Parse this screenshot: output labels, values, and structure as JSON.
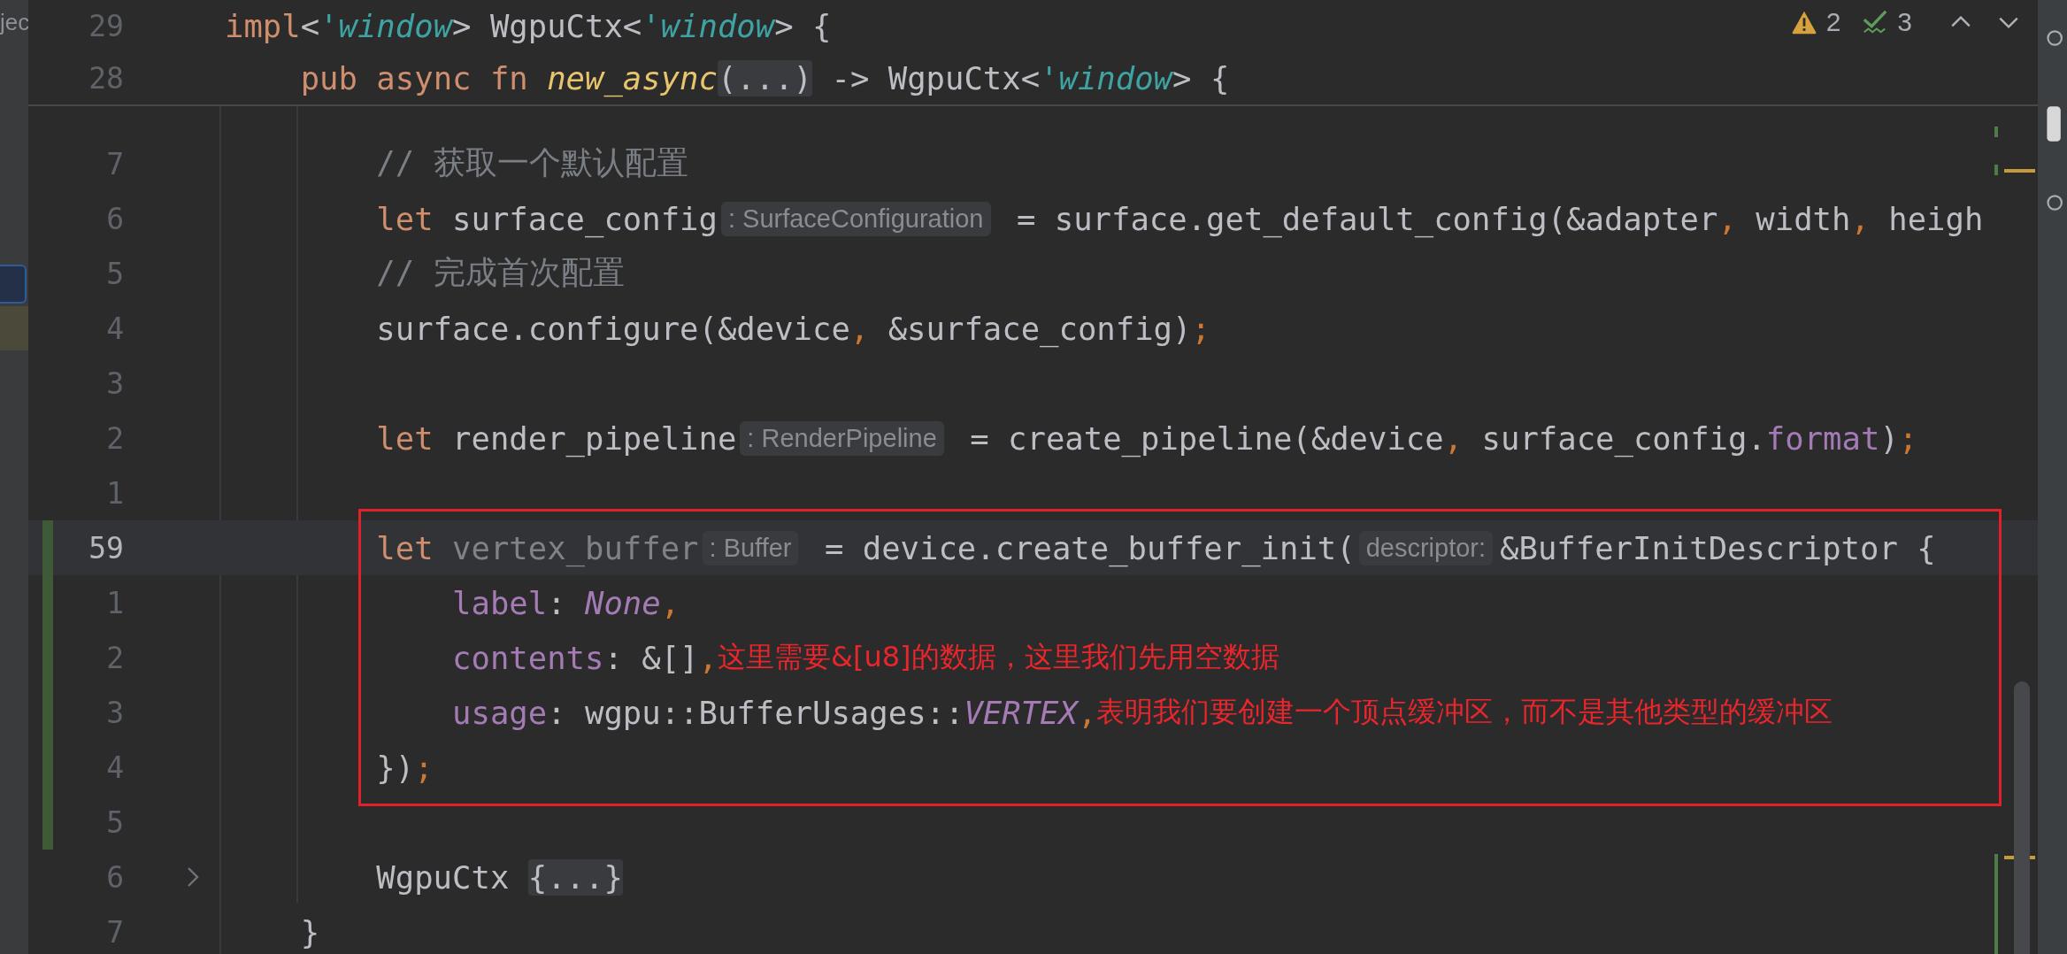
{
  "project_panel": {
    "text": "jec"
  },
  "inspections": [
    {
      "kind": "warning",
      "count": "2"
    },
    {
      "kind": "weak",
      "count": "3"
    }
  ],
  "sticky_lines": [
    {
      "number": "29",
      "segments": [
        {
          "kind": "code",
          "tokens": [
            {
              "kind": "kw",
              "text": "impl"
            },
            {
              "kind": "plain",
              "text": "<"
            },
            {
              "kind": "lifetime",
              "text": "'window"
            },
            {
              "kind": "plain",
              "text": "> WgpuCtx<"
            },
            {
              "kind": "lifetime",
              "text": "'window"
            },
            {
              "kind": "plain",
              "text": "> {"
            }
          ]
        }
      ]
    },
    {
      "number": "28",
      "segments": [
        {
          "kind": "code",
          "tokens": [
            {
              "kind": "kw",
              "text": "    pub async fn "
            },
            {
              "kind": "fn",
              "text": "new_async"
            }
          ]
        },
        {
          "kind": "fold",
          "text": "(...)"
        },
        {
          "kind": "code",
          "tokens": [
            {
              "kind": "plain",
              "text": " -> WgpuCtx<"
            },
            {
              "kind": "lifetime",
              "text": "'window"
            },
            {
              "kind": "plain",
              "text": "> {"
            }
          ]
        }
      ]
    }
  ],
  "lines": [
    {
      "number": "7",
      "current": false,
      "changed": false,
      "foldable": false,
      "segments": [
        {
          "kind": "code",
          "tokens": [
            {
              "kind": "comment",
              "text": "        // 获取一个默认配置"
            }
          ]
        }
      ]
    },
    {
      "number": "6",
      "current": false,
      "changed": false,
      "foldable": false,
      "segments": [
        {
          "kind": "code",
          "tokens": [
            {
              "kind": "kw",
              "text": "        let "
            },
            {
              "kind": "plain",
              "text": "surface_config"
            }
          ]
        },
        {
          "kind": "hint",
          "text": ": SurfaceConfiguration"
        },
        {
          "kind": "code",
          "tokens": [
            {
              "kind": "plain",
              "text": " = surface.get_default_config(&adapter"
            },
            {
              "kind": "punct",
              "text": ","
            },
            {
              "kind": "plain",
              "text": " width"
            },
            {
              "kind": "punct",
              "text": ","
            },
            {
              "kind": "plain",
              "text": " heigh"
            }
          ]
        }
      ]
    },
    {
      "number": "5",
      "current": false,
      "changed": false,
      "foldable": false,
      "segments": [
        {
          "kind": "code",
          "tokens": [
            {
              "kind": "comment",
              "text": "        // 完成首次配置"
            }
          ]
        }
      ]
    },
    {
      "number": "4",
      "current": false,
      "changed": false,
      "foldable": false,
      "segments": [
        {
          "kind": "code",
          "tokens": [
            {
              "kind": "plain",
              "text": "        surface.configure(&device"
            },
            {
              "kind": "punct",
              "text": ","
            },
            {
              "kind": "plain",
              "text": " &surface_config)"
            },
            {
              "kind": "punct",
              "text": ";"
            }
          ]
        }
      ]
    },
    {
      "number": "3",
      "current": false,
      "changed": false,
      "foldable": false
    },
    {
      "number": "2",
      "current": false,
      "changed": false,
      "foldable": false,
      "segments": [
        {
          "kind": "code",
          "tokens": [
            {
              "kind": "kw",
              "text": "        let "
            },
            {
              "kind": "plain",
              "text": "render_pipeline"
            }
          ]
        },
        {
          "kind": "hint",
          "text": ": RenderPipeline"
        },
        {
          "kind": "code",
          "tokens": [
            {
              "kind": "plain",
              "text": " = create_pipeline(&device"
            },
            {
              "kind": "punct",
              "text": ","
            },
            {
              "kind": "plain",
              "text": " surface_config."
            },
            {
              "kind": "field",
              "text": "format"
            },
            {
              "kind": "plain",
              "text": ")"
            },
            {
              "kind": "punct",
              "text": ";"
            }
          ]
        }
      ]
    },
    {
      "number": "1",
      "current": false,
      "changed": false,
      "foldable": false
    },
    {
      "number": "59",
      "current": true,
      "changed": true,
      "foldable": false,
      "segments": [
        {
          "kind": "code",
          "tokens": [
            {
              "kind": "kw",
              "text": "        let "
            },
            {
              "kind": "unused",
              "text": "vertex_buffer"
            }
          ]
        },
        {
          "kind": "hint",
          "text": ": Buffer"
        },
        {
          "kind": "code",
          "tokens": [
            {
              "kind": "plain",
              "text": " = device.create_buffer_init("
            }
          ]
        },
        {
          "kind": "hint",
          "text": "descriptor:"
        },
        {
          "kind": "code",
          "tokens": [
            {
              "kind": "plain",
              "text": "&BufferInitDescriptor {"
            }
          ]
        }
      ]
    },
    {
      "number": "1",
      "current": false,
      "changed": true,
      "foldable": false,
      "segments": [
        {
          "kind": "code",
          "tokens": [
            {
              "kind": "field",
              "text": "            label"
            },
            {
              "kind": "plain",
              "text": ": "
            },
            {
              "kind": "constant",
              "text": "None"
            },
            {
              "kind": "punct",
              "text": ","
            }
          ]
        }
      ]
    },
    {
      "number": "2",
      "current": false,
      "changed": true,
      "foldable": false,
      "segments": [
        {
          "kind": "code",
          "tokens": [
            {
              "kind": "field",
              "text": "            contents"
            },
            {
              "kind": "plain",
              "text": ": &[]"
            },
            {
              "kind": "punct",
              "text": ","
            }
          ]
        },
        {
          "kind": "note",
          "text": "这里需要&[u8]的数据，这里我们先用空数据"
        }
      ]
    },
    {
      "number": "3",
      "current": false,
      "changed": true,
      "foldable": false,
      "segments": [
        {
          "kind": "code",
          "tokens": [
            {
              "kind": "field",
              "text": "            usage"
            },
            {
              "kind": "plain",
              "text": ": wgpu::BufferUsages::"
            },
            {
              "kind": "constant",
              "text": "VERTEX"
            },
            {
              "kind": "punct",
              "text": ","
            }
          ]
        },
        {
          "kind": "note",
          "text": "表明我们要创建一个顶点缓冲区，而不是其他类型的缓冲区"
        }
      ]
    },
    {
      "number": "4",
      "current": false,
      "changed": true,
      "foldable": false,
      "segments": [
        {
          "kind": "code",
          "tokens": [
            {
              "kind": "plain",
              "text": "        })"
            },
            {
              "kind": "punct",
              "text": ";"
            }
          ]
        }
      ]
    },
    {
      "number": "5",
      "current": false,
      "changed": true,
      "foldable": false
    },
    {
      "number": "6",
      "current": false,
      "changed": false,
      "foldable": true,
      "segments": [
        {
          "kind": "code",
          "tokens": [
            {
              "kind": "plain",
              "text": "        WgpuCtx "
            }
          ]
        },
        {
          "kind": "fold",
          "text": "{...}"
        }
      ]
    },
    {
      "number": "7",
      "current": false,
      "changed": false,
      "foldable": false,
      "segments": [
        {
          "kind": "code",
          "tokens": [
            {
              "kind": "plain",
              "text": "    }"
            }
          ]
        }
      ]
    }
  ]
}
